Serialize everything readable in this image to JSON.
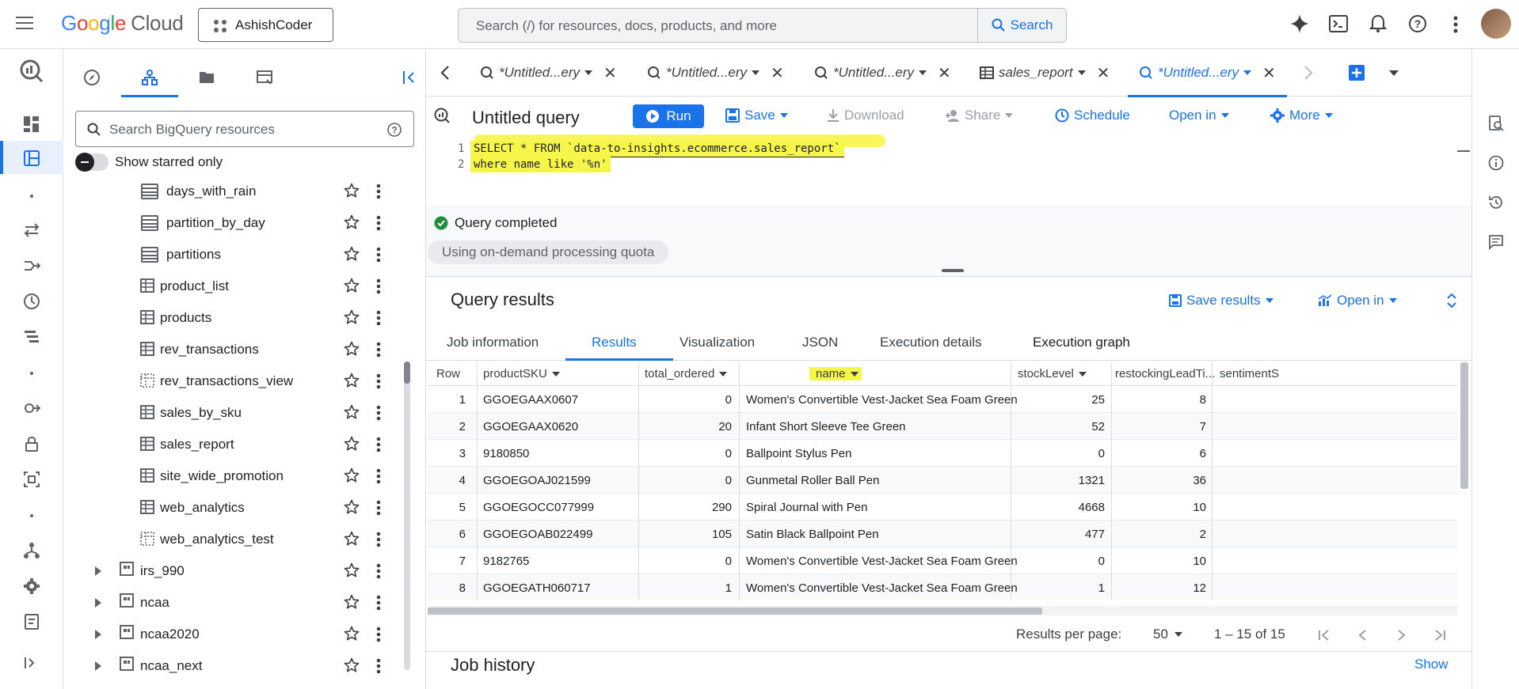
{
  "topbar": {
    "logo_google": [
      "G",
      "o",
      "o",
      "g",
      "l",
      "e"
    ],
    "logo_cloud": "Cloud",
    "project": "AshishCoder",
    "search_placeholder": "Search (/) for resources, docs, products, and more",
    "search_button": "Search"
  },
  "explorer": {
    "search_placeholder": "Search BigQuery resources",
    "starred_label": "Show starred only",
    "items": [
      {
        "label": "days_with_rain",
        "icon": "partitioned-table-icon"
      },
      {
        "label": "partition_by_day",
        "icon": "partitioned-table-icon"
      },
      {
        "label": "partitions",
        "icon": "partitioned-table-icon"
      },
      {
        "label": "product_list",
        "icon": "table-icon"
      },
      {
        "label": "products",
        "icon": "table-icon"
      },
      {
        "label": "rev_transactions",
        "icon": "table-icon"
      },
      {
        "label": "rev_transactions_view",
        "icon": "view-icon"
      },
      {
        "label": "sales_by_sku",
        "icon": "table-icon"
      },
      {
        "label": "sales_report",
        "icon": "table-icon"
      },
      {
        "label": "site_wide_promotion",
        "icon": "table-icon"
      },
      {
        "label": "web_analytics",
        "icon": "table-icon"
      },
      {
        "label": "web_analytics_test",
        "icon": "view-icon"
      }
    ],
    "datasets": [
      "irs_990",
      "ncaa",
      "ncaa2020",
      "ncaa_next"
    ]
  },
  "tabs": [
    {
      "label": "*Untitled...ery"
    },
    {
      "label": "*Untitled...ery"
    },
    {
      "label": "*Untitled...ery"
    },
    {
      "label": "sales_report"
    },
    {
      "label": "*Untitled...ery"
    }
  ],
  "query": {
    "title": "Untitled query",
    "run": "Run",
    "save": "Save",
    "download": "Download",
    "share": "Share",
    "schedule": "Schedule",
    "open_in": "Open in",
    "more": "More",
    "line1": "SELECT * FROM `data-to-insights.ecommerce.sales_report`",
    "line2": "where name like '%n'",
    "status": "Query completed",
    "quota": "Using on-demand processing quota"
  },
  "results": {
    "title": "Query results",
    "save_results": "Save results",
    "open_in": "Open in",
    "tabs": [
      "Job information",
      "Results",
      "Visualization",
      "JSON",
      "Execution details",
      "Execution graph"
    ],
    "columns": [
      "Row",
      "productSKU",
      "total_ordered",
      "name",
      "stockLevel",
      "restockingLeadTi...",
      "sentimentS"
    ],
    "rows": [
      [
        "1",
        "GGOEGAAX0607",
        "0",
        "Women's Convertible Vest-Jacket Sea Foam Green",
        "25",
        "8"
      ],
      [
        "2",
        "GGOEGAAX0620",
        "20",
        "Infant Short Sleeve Tee Green",
        "52",
        "7"
      ],
      [
        "3",
        "9180850",
        "0",
        "Ballpoint Stylus Pen",
        "0",
        "6"
      ],
      [
        "4",
        "GGOEGOAJ021599",
        "0",
        "Gunmetal Roller Ball Pen",
        "1321",
        "36"
      ],
      [
        "5",
        "GGOEGOCC077999",
        "290",
        "Spiral Journal with Pen",
        "4668",
        "10"
      ],
      [
        "6",
        "GGOEGOAB022499",
        "105",
        "Satin Black Ballpoint Pen",
        "477",
        "2"
      ],
      [
        "7",
        "9182765",
        "0",
        "Women's Convertible Vest-Jacket Sea Foam Green",
        "0",
        "10"
      ],
      [
        "8",
        "GGOEGATH060717",
        "1",
        "Women's Convertible Vest-Jacket Sea Foam Green",
        "1",
        "12"
      ]
    ],
    "per_page_label": "Results per page:",
    "per_page_value": "50",
    "range": "1 – 15 of 15"
  },
  "job_history": {
    "title": "Job history",
    "show": "Show"
  },
  "colors": {
    "accent": "#1a73e8",
    "highlight": "#f6f64a",
    "success": "#1e8e3e"
  }
}
